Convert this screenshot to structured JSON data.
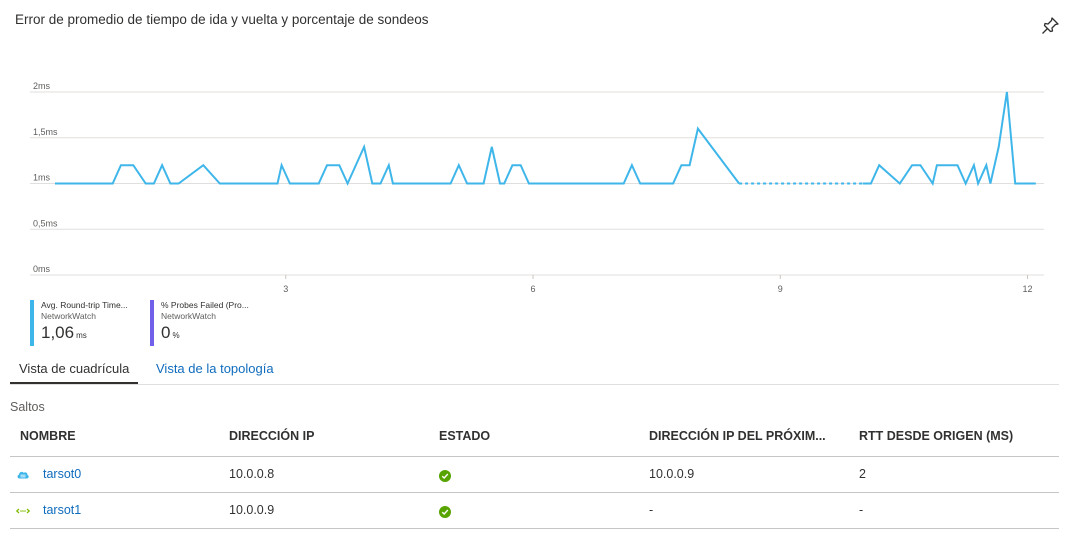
{
  "title": "Error de promedio de tiempo de ida y vuelta y porcentaje de sondeos",
  "chart_data": {
    "type": "line",
    "y_tick_labels": [
      "2ms",
      "1,5ms",
      "1ms",
      "0,5ms",
      "0ms"
    ],
    "x_tick_labels": [
      "3",
      "6",
      "9",
      "12"
    ],
    "x_ticks": [
      3,
      6,
      9,
      12
    ],
    "xlim": [
      0.2,
      12.2
    ],
    "ylim": [
      0,
      2
    ],
    "grid": true,
    "series": [
      {
        "name": "Avg. Round-trip Time...",
        "color": "#3fb6ea",
        "x": [
          0.2,
          0.9,
          1.0,
          1.15,
          1.3,
          1.4,
          1.5,
          1.6,
          1.7,
          2.0,
          2.2,
          2.3,
          2.9,
          2.95,
          3.05,
          3.4,
          3.5,
          3.65,
          3.75,
          3.95,
          4.05,
          4.15,
          4.25,
          4.3,
          4.45,
          4.55,
          5.0,
          5.1,
          5.2,
          5.4,
          5.5,
          5.6,
          5.65,
          5.75,
          5.85,
          5.95,
          6.0,
          7.1,
          7.2,
          7.3,
          7.7,
          7.8,
          7.9,
          8.0,
          8.5,
          8.6,
          10.0,
          10.1,
          10.2,
          10.45,
          10.6,
          10.7,
          10.85,
          10.9,
          11.0,
          11.15,
          11.25,
          11.35,
          11.4,
          11.5,
          11.55,
          11.65,
          11.75,
          11.85,
          11.95,
          12.1
        ],
        "y": [
          1.0,
          1.0,
          1.2,
          1.2,
          1.0,
          1.0,
          1.2,
          1.0,
          1.0,
          1.2,
          1.0,
          1.0,
          1.0,
          1.2,
          1.0,
          1.0,
          1.2,
          1.2,
          1.0,
          1.4,
          1.0,
          1.0,
          1.2,
          1.0,
          1.0,
          1.0,
          1.0,
          1.2,
          1.0,
          1.0,
          1.4,
          1.0,
          1.0,
          1.2,
          1.2,
          1.0,
          1.0,
          1.0,
          1.2,
          1.0,
          1.0,
          1.2,
          1.2,
          1.6,
          1.0,
          1.0,
          1.0,
          1.0,
          1.2,
          1.0,
          1.2,
          1.2,
          1.0,
          1.2,
          1.2,
          1.2,
          1.0,
          1.2,
          1.0,
          1.2,
          1.0,
          1.4,
          2.0,
          1.0,
          1.0,
          1.0
        ],
        "dashed_range": [
          8.5,
          10.0
        ]
      },
      {
        "name": "% Probes Failed (Pro...",
        "color": "#7160e8",
        "x": [
          0.2,
          12.1
        ],
        "y": [
          0,
          0
        ],
        "dashed_range": [
          8.5,
          10.0
        ]
      }
    ]
  },
  "legend": [
    {
      "name": "Avg. Round-trip Time...",
      "source": "NetworkWatch",
      "value": "1,06",
      "unit": "ms",
      "color": "#3fb6ea"
    },
    {
      "name": "% Probes Failed (Pro...",
      "source": "NetworkWatch",
      "value": "0",
      "unit": "%",
      "color": "#7160e8"
    }
  ],
  "tabs": [
    {
      "label": "Vista de cuadrícula",
      "active": true
    },
    {
      "label": "Vista de la topología",
      "active": false
    }
  ],
  "section_title": "Saltos",
  "table": {
    "columns": [
      "NOMBRE",
      "DIRECCIÓN IP",
      "ESTADO",
      "DIRECCIÓN IP DEL PRÓXIM...",
      "RTT DESDE ORIGEN (MS)"
    ],
    "rows": [
      {
        "icon": "vm-icon",
        "name": "tarsot0",
        "ip": "10.0.0.8",
        "status": "ok",
        "next_ip": "10.0.0.9",
        "rtt": "2"
      },
      {
        "icon": "network-interface-icon",
        "name": "tarsot1",
        "ip": "10.0.0.9",
        "status": "ok",
        "next_ip": "-",
        "rtt": "-"
      }
    ]
  },
  "icons": {
    "pin": "pin-icon",
    "status_ok": "check-circle-icon"
  },
  "colors": {
    "accent": "#0f6cbd",
    "ok": "#57a300"
  }
}
